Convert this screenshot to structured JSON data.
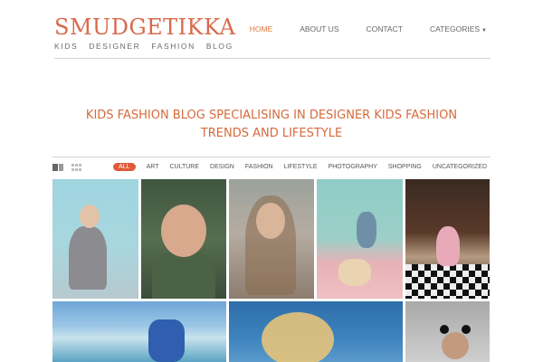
{
  "logo": {
    "title": "SMUDGETIKKA",
    "subtitle": "KIDS DESIGNER FASHION BLOG"
  },
  "nav": {
    "items": [
      {
        "label": "HOME",
        "active": true
      },
      {
        "label": "ABOUT US",
        "active": false
      },
      {
        "label": "CONTACT",
        "active": false
      },
      {
        "label": "CATEGORIES",
        "active": false,
        "has_dropdown": true
      }
    ]
  },
  "tagline": {
    "line1": "KIDS FASHION BLOG SPECIALISING IN DESIGNER KIDS FASHION",
    "line2": "TRENDS AND LIFESTYLE"
  },
  "view_toggle": {
    "icons": [
      "list-view-icon",
      "grid-view-icon"
    ]
  },
  "filters": {
    "items": [
      "ALL",
      "ART",
      "CULTURE",
      "DESIGN",
      "FASHION",
      "LIFESTYLE",
      "PHOTOGRAPHY",
      "SHOPPING",
      "UNCATEGORIZED"
    ],
    "active": "ALL"
  },
  "colors": {
    "brand": "#d9694a",
    "nav_active": "#e07a3e",
    "filter_active_bg": "#e05a3a"
  },
  "tiles": [
    "post-thumbnail",
    "post-thumbnail",
    "post-thumbnail",
    "post-thumbnail",
    "post-thumbnail",
    "post-thumbnail",
    "post-thumbnail",
    "post-thumbnail"
  ]
}
